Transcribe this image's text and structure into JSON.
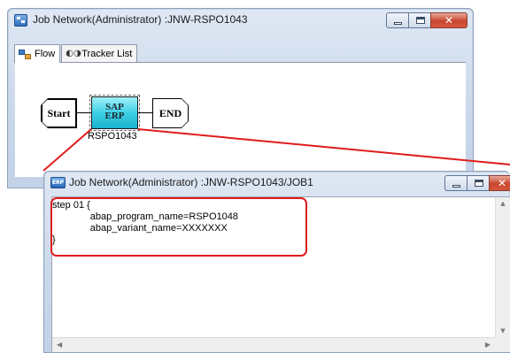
{
  "window1": {
    "title": "Job Network(Administrator) :JNW-RSPO1043",
    "tabs": [
      {
        "label": "Flow",
        "active": true,
        "icon": "flow-icon"
      },
      {
        "label": "Tracker List",
        "active": false,
        "icon": "tracker-icon"
      }
    ],
    "flow": {
      "start_label": "Start",
      "end_label": "END",
      "job_node": {
        "line1": "SAP",
        "line2": "ERP",
        "name": "RSPO1043",
        "color": "#3fd0e6"
      }
    }
  },
  "window2": {
    "title": "Job Network(Administrator) :JNW-RSPO1043/JOB1",
    "icon_text": "ERP",
    "code_lines": [
      "step 01 {",
      "              abap_program_name=RSPO1048",
      "              abap_variant_name=XXXXXXX",
      "}"
    ]
  },
  "colors": {
    "highlight": "#e01c1c",
    "close_button": "#c9452f"
  }
}
